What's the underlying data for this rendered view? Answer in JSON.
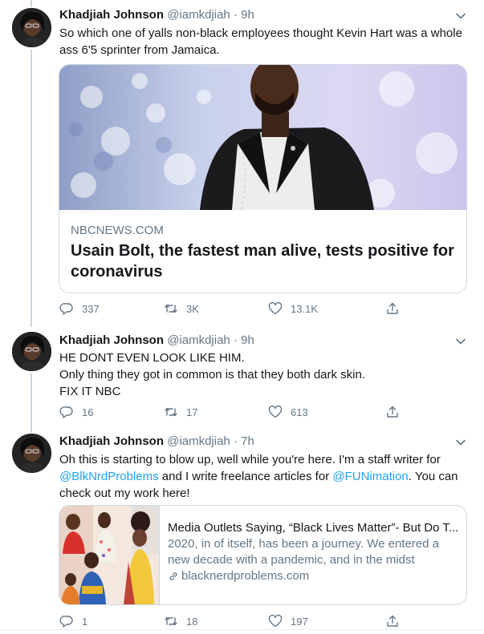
{
  "tweets": [
    {
      "name": "Khadjiah Johnson",
      "handle": "@iamkdjiah",
      "dot": "·",
      "time": "9h",
      "lines": [
        "So which one of yalls non-black employees thought Kevin Hart was a whole",
        "ass 6'5 sprinter from Jamaica."
      ],
      "card": {
        "domain": "NBCNEWS.COM",
        "title": "Usain Bolt, the fastest man alive, tests positive for coronavirus"
      },
      "actions": {
        "replies": "337",
        "retweets": "3K",
        "likes": "13.1K"
      }
    },
    {
      "name": "Khadjiah Johnson",
      "handle": "@iamkdjiah",
      "dot": "·",
      "time": "9h",
      "lines": [
        "HE DONT EVEN LOOK LIKE HIM.",
        "Only thing they got in common is that they both dark skin.",
        "FIX IT NBC"
      ],
      "actions": {
        "replies": "16",
        "retweets": "17",
        "likes": "613"
      }
    },
    {
      "name": "Khadjiah Johnson",
      "handle": "@iamkdjiah",
      "dot": "·",
      "time": "7h",
      "text": {
        "part1": "Oh this is starting to blow up, well while you're here. I'm a staff writer for",
        "mention1": "@BlkNrdProblems",
        "part2": " and I write freelance articles for ",
        "mention2": "@FUNimation",
        "part3": ". You can",
        "part4": "check out my work here!"
      },
      "card": {
        "title": "Media Outlets Saying, “Black Lives Matter”- But Do T...",
        "desc_line1": "2020, in of itself, has been a journey. We entered a",
        "desc_line2": "new decade with a pandemic, and in the midst",
        "link": "blacknerdproblems.com"
      },
      "actions": {
        "replies": "1",
        "retweets": "18",
        "likes": "197"
      }
    }
  ],
  "colors": {
    "text": "#14171a",
    "secondary": "#657786",
    "link": "#1da1f2",
    "border": "#ccd6dd"
  },
  "icons": [
    "chevron-down-icon",
    "reply-icon",
    "retweet-icon",
    "like-icon",
    "share-icon",
    "link-icon"
  ]
}
